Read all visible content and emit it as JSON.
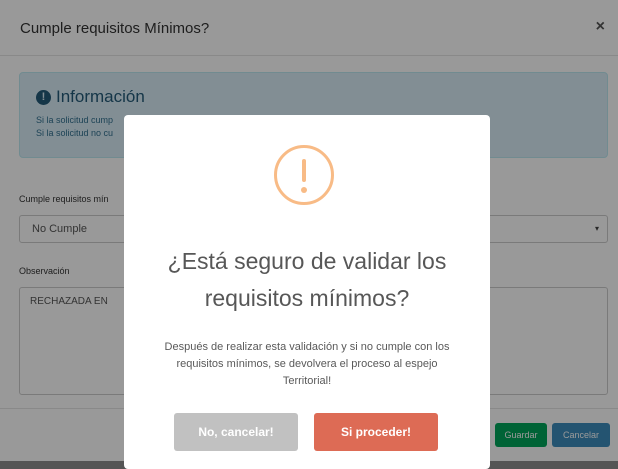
{
  "modal": {
    "title": "Cumple requisitos Mínimos?",
    "close_label": "×",
    "info": {
      "icon": "info-circle-icon",
      "icon_glyph": "!",
      "title": "Información",
      "line1": "Si la solicitud cump",
      "line2": "Si la solicitud no cu"
    },
    "requisitos_label": "Cumple requisitos mín",
    "requisitos_value": "No Cumple",
    "select_arrow": "▾",
    "observacion_label": "Observación",
    "observacion_value": "RECHAZADA EN",
    "buttons": {
      "guardar": "Guardar",
      "cancelar": "Cancelar"
    }
  },
  "alert": {
    "icon": "warning-icon",
    "icon_color": "#f8bb86",
    "title_line1": "¿Está seguro de validar los",
    "title_line2": "requisitos mínimos?",
    "text_line1": "Después de realizar esta validación y si no cumple con los",
    "text_line2": "requisitos mínimos, se devolvera el proceso al espejo",
    "text_line3": "Territorial!",
    "cancel_label": "No, cancelar!",
    "confirm_label": "Si proceder!",
    "cancel_color": "#c1c1c1",
    "confirm_color": "#dd6b55"
  }
}
